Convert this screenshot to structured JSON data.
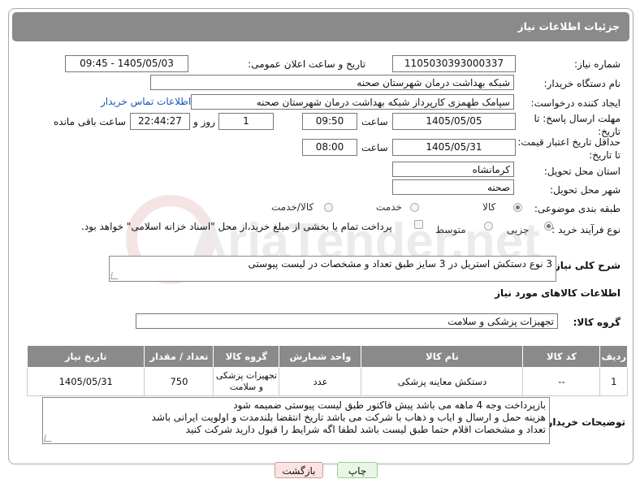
{
  "panel_title": "جزئیات اطلاعات نیاز",
  "watermark_text": "AriaTender.net",
  "fields": {
    "need_number_label": "شماره نیاز:",
    "need_number": "1105030393000337",
    "announce_label": "تاریخ و ساعت اعلان عمومی:",
    "announce_value": "1405/05/03 - 09:45",
    "buyer_org_label": "نام دستگاه خریدار:",
    "buyer_org": "شبکه بهداشت درمان شهرستان صحنه",
    "requester_label": "ایجاد کننده درخواست:",
    "requester": "سپامک طهمزی کارپرداز شبکه بهداشت درمان شهرستان صحنه",
    "buyer_contact_link": "اطلاعات تماس خریدار",
    "reply_deadline_label": "مهلت ارسال پاسخ: تا تاریخ:",
    "reply_date": "1405/05/05",
    "time_label": "ساعت",
    "reply_time": "09:50",
    "days": "1",
    "days_label": "روز و",
    "remaining_time": "22:44:27",
    "remaining_label": "ساعت باقی مانده",
    "price_validity_label": "حداقل تاریخ اعتبار قیمت: تا تاریخ:",
    "price_date": "1405/05/31",
    "price_time_label": "ساعت",
    "price_time": "08:00",
    "province_label": "استان محل تحویل:",
    "province": "کرمانشاه",
    "city_label": "شهر محل تحویل:",
    "city": "صحنه",
    "category_label": "طبقه بندی موضوعی:",
    "category_options": [
      "کالا",
      "خدمت",
      "کالا/خدمت"
    ],
    "category_selected": "کالا",
    "process_label": "نوع فرآیند خرید :",
    "process_options": [
      "جزیی",
      "متوسط"
    ],
    "process_selected": "جزیی",
    "payment_note": "پرداخت تمام یا بخشی از مبلغ خرید،از محل \"اسناد خزانه اسلامی\" خواهد بود."
  },
  "description": {
    "label": "شرح کلی نیاز:",
    "value": "3 نوع دستکش استریل در 3 سایز طبق تعداد و مشخصات در لیست پیوستی"
  },
  "goods_section": {
    "title": "اطلاعات کالاهای مورد نیاز",
    "group_label": "گروه کالا:",
    "group_value": "تجهیزات پزشکی و سلامت",
    "columns": [
      "ردیف",
      "کد کالا",
      "نام کالا",
      "واحد شمارش",
      "گروه کالا",
      "تعداد / مقدار",
      "تاریخ نیاز"
    ],
    "rows": [
      {
        "row": "1",
        "code": "--",
        "name": "دستکش معاینه پزشکی",
        "unit": "عدد",
        "group": "تجهیزات پزشکی و سلامت",
        "qty": "750",
        "date": "1405/05/31"
      }
    ]
  },
  "buyer_notes": {
    "label": "توضیحات خریدار:",
    "lines": [
      "بازپرداخت وجه 4 ماهه می باشد پیش فاکتور طبق لیست پیوستی ضمیمه شود",
      "هزینه حمل و ارسال و ایاب و ذهاب با شرکت می باشد تاریخ انتقضا بلندمدت و اولویت ایرانی باشد",
      "تعداد و مشخصات اقلام حتما طبق لیست باشد  لطفا اگه شرایط را قبول دارید شرکت کنید"
    ]
  },
  "buttons": {
    "print": "چاپ",
    "return": "بازگشت"
  }
}
